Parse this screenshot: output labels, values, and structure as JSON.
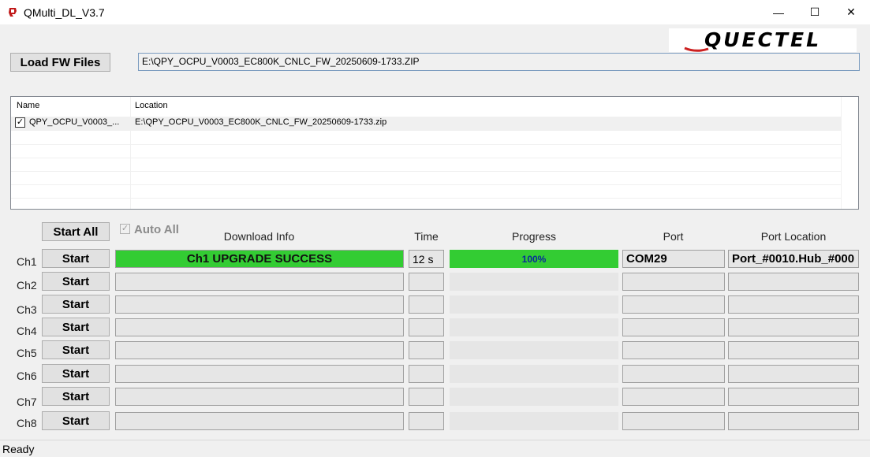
{
  "window": {
    "title": "QMulti_DL_V3.7",
    "app_icon": "quectel-q-icon",
    "minimize_icon": "—",
    "maximize_icon": "☐",
    "close_icon": "✕"
  },
  "logo": {
    "text": "QUECTEL",
    "accent_color": "#cc2020"
  },
  "toolbar": {
    "load_label": "Load FW Files",
    "fw_path": "E:\\QPY_OCPU_V0003_EC800K_CNLC_FW_20250609-1733.ZIP"
  },
  "file_list": {
    "columns": [
      "Name",
      "Location"
    ],
    "rows": [
      {
        "checked": true,
        "name": "QPY_OCPU_V0003_...",
        "location": "E:\\QPY_OCPU_V0003_EC800K_CNLC_FW_20250609-1733.zip"
      }
    ]
  },
  "controls": {
    "start_all_label": "Start All",
    "auto_all_label": "Auto All",
    "auto_all_checked": true,
    "auto_all_check_glyph": "✓"
  },
  "columns": {
    "download_info": "Download Info",
    "time": "Time",
    "progress": "Progress",
    "port": "Port",
    "port_location": "Port Location"
  },
  "channels": [
    {
      "label": "Ch1",
      "start": "Start",
      "info": "Ch1 UPGRADE SUCCESS",
      "time": "12 s",
      "progress": "100%",
      "progress_value": 1.0,
      "port": "COM29",
      "port_location": "Port_#0010.Hub_#000"
    },
    {
      "label": "Ch2",
      "start": "Start",
      "info": "",
      "time": "",
      "progress": "",
      "progress_value": 0,
      "port": "",
      "port_location": ""
    },
    {
      "label": "Ch3",
      "start": "Start",
      "info": "",
      "time": "",
      "progress": "",
      "progress_value": 0,
      "port": "",
      "port_location": ""
    },
    {
      "label": "Ch4",
      "start": "Start",
      "info": "",
      "time": "",
      "progress": "",
      "progress_value": 0,
      "port": "",
      "port_location": ""
    },
    {
      "label": "Ch5",
      "start": "Start",
      "info": "",
      "time": "",
      "progress": "",
      "progress_value": 0,
      "port": "",
      "port_location": ""
    },
    {
      "label": "Ch6",
      "start": "Start",
      "info": "",
      "time": "",
      "progress": "",
      "progress_value": 0,
      "port": "",
      "port_location": ""
    },
    {
      "label": "Ch7",
      "start": "Start",
      "info": "",
      "time": "",
      "progress": "",
      "progress_value": 0,
      "port": "",
      "port_location": ""
    },
    {
      "label": "Ch8",
      "start": "Start",
      "info": "",
      "time": "",
      "progress": "",
      "progress_value": 0,
      "port": "",
      "port_location": ""
    }
  ],
  "colors": {
    "success_green": "#33cc33",
    "progress_text": "#0a2a9a"
  },
  "status": {
    "text": "Ready"
  }
}
